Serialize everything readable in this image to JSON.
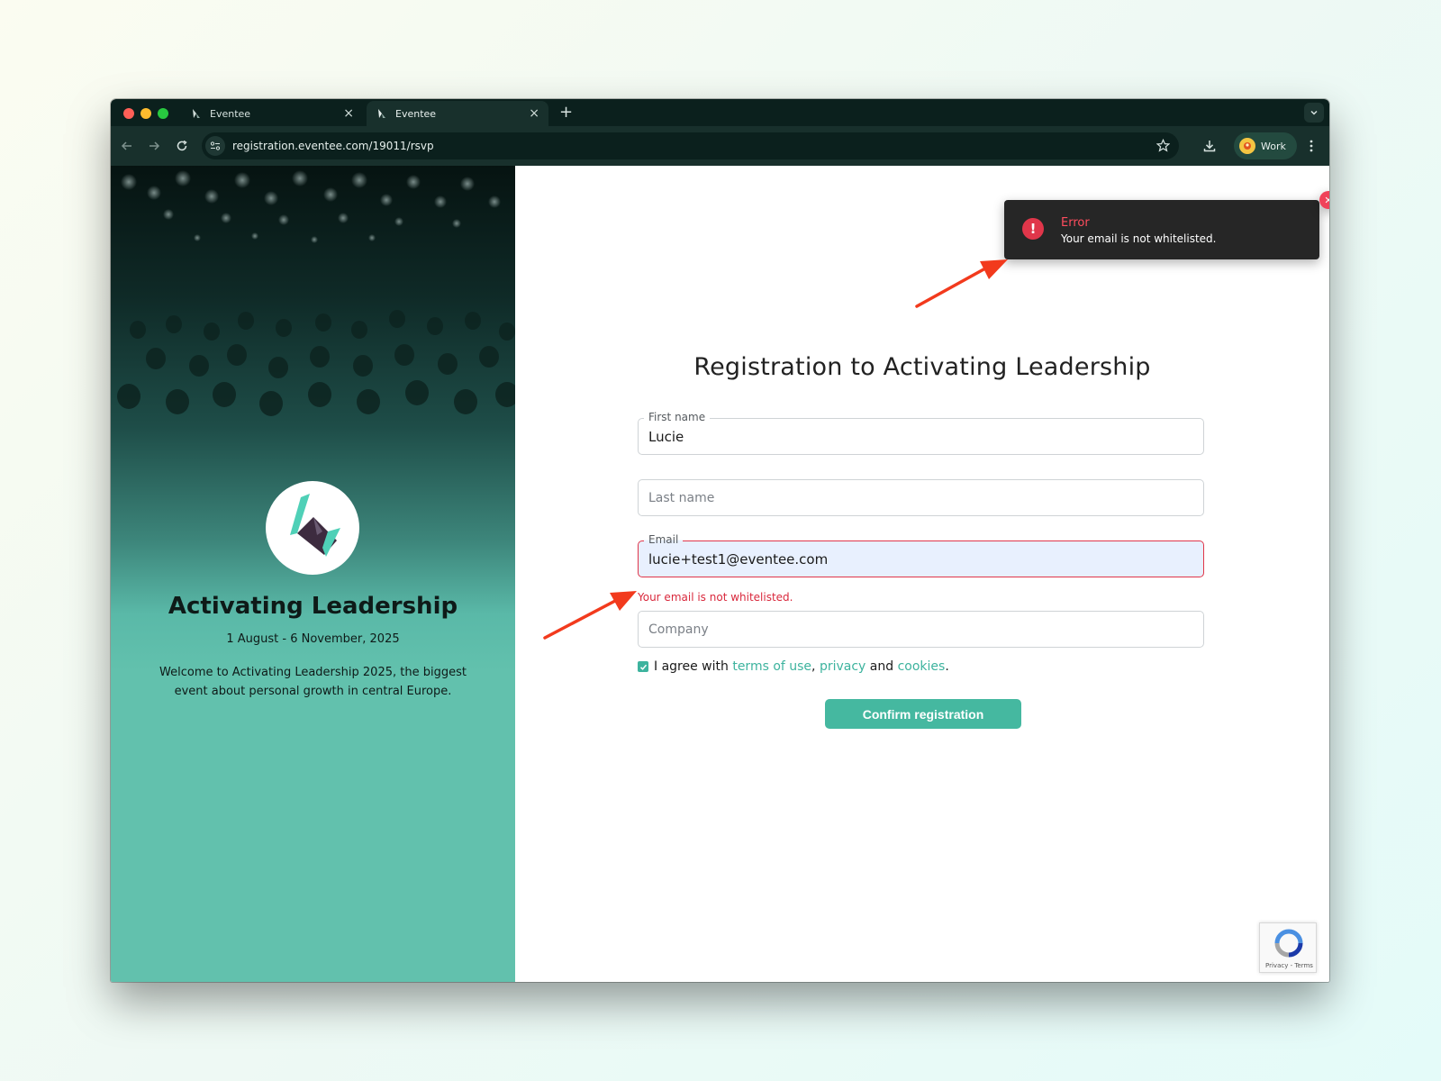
{
  "browser": {
    "tabs": [
      {
        "title": "Eventee",
        "active": false
      },
      {
        "title": "Eventee",
        "active": true
      }
    ],
    "url": "registration.eventee.com/19011/rsvp",
    "profile_label": "Work"
  },
  "event": {
    "title": "Activating Leadership",
    "dates": "1 August - 6 November, 2025",
    "description": "Welcome to Activating Leadership 2025, the biggest event about personal growth in central Europe."
  },
  "form": {
    "title": "Registration to Activating Leadership",
    "first_name": {
      "label": "First name",
      "value": "Lucie"
    },
    "last_name": {
      "placeholder": "Last name"
    },
    "email": {
      "label": "Email",
      "value": "lucie+test1@eventee.com",
      "error": "Your email is not whitelisted."
    },
    "company": {
      "placeholder": "Company"
    },
    "agree": {
      "prefix": "I agree with",
      "terms": "terms of use",
      "sep1": ",",
      "privacy": "privacy",
      "and": "and",
      "cookies": "cookies",
      "end": ".",
      "checked": true
    },
    "submit_label": "Confirm registration"
  },
  "toast": {
    "title": "Error",
    "message": "Your email is not whitelisted."
  },
  "recaptcha": {
    "links": "Privacy - Terms"
  },
  "colors": {
    "accent": "#45b8a0",
    "error": "#e0364a",
    "panel": "#62c1ad",
    "annotation_arrow": "#f23a1d"
  }
}
